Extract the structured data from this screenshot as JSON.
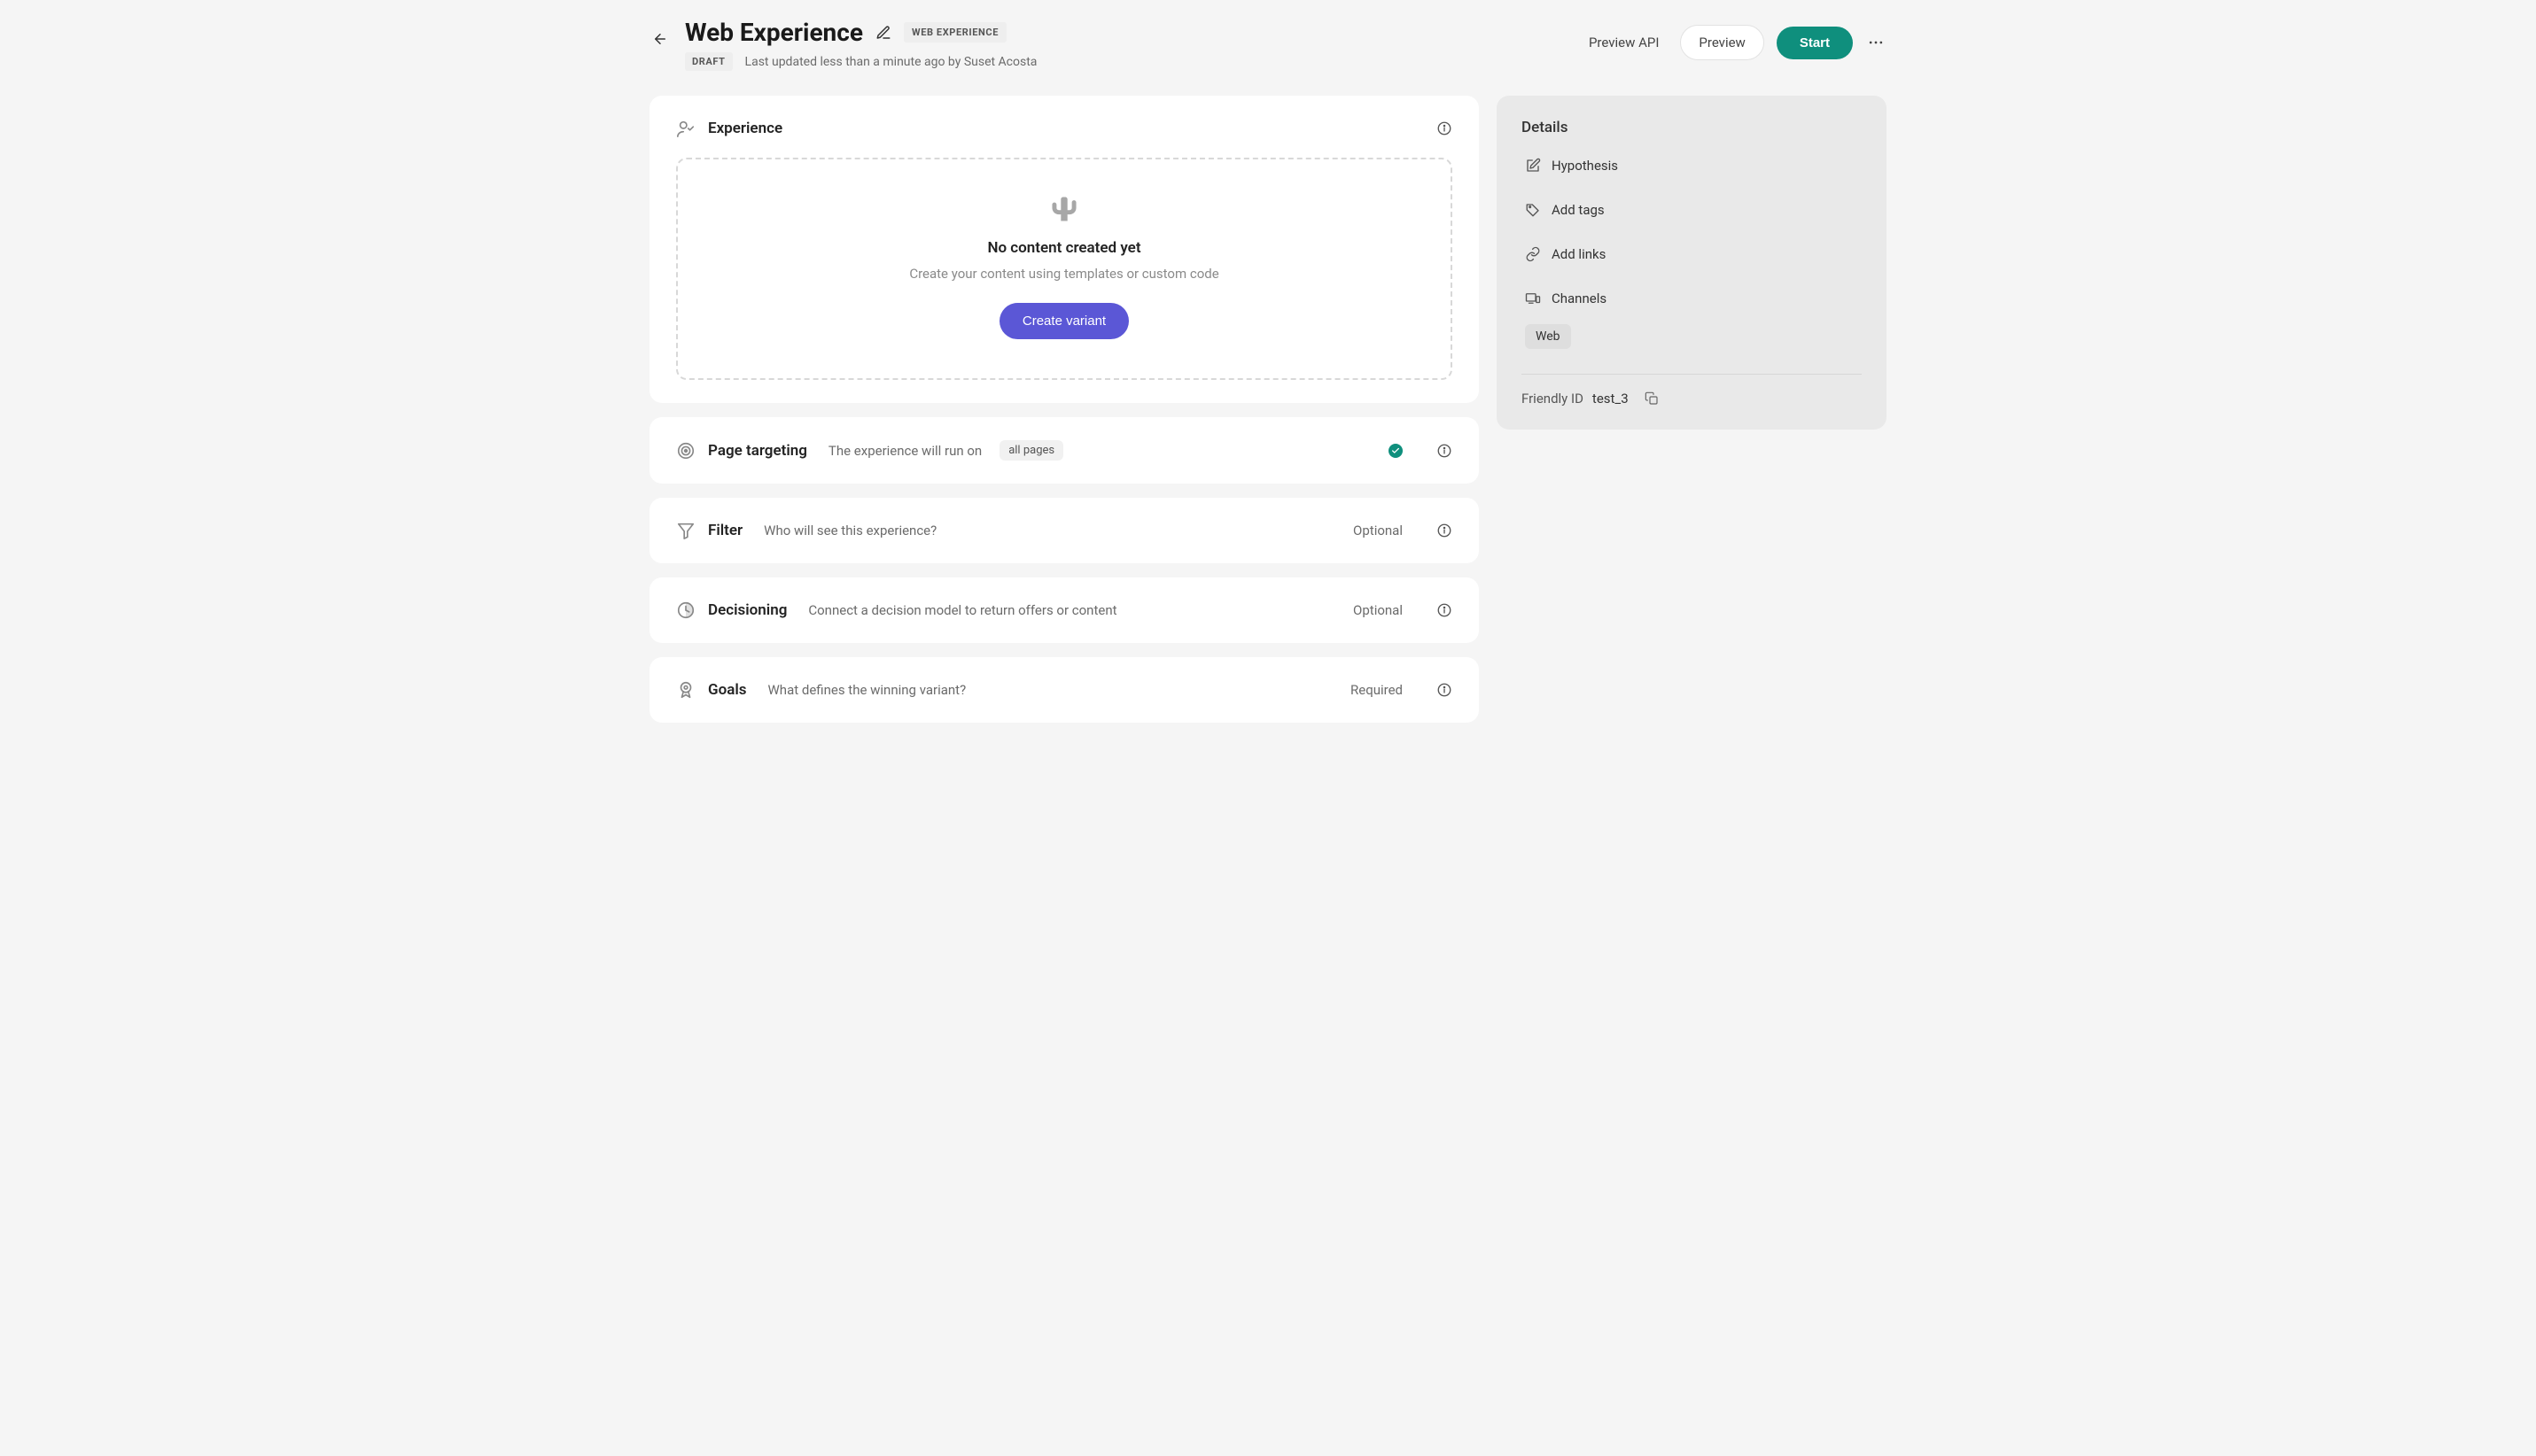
{
  "header": {
    "title": "Web Experience",
    "type_chip": "WEB EXPERIENCE",
    "status_chip": "DRAFT",
    "updated": "Last updated less than a minute ago by Suset Acosta",
    "preview_api": "Preview API",
    "preview": "Preview",
    "start": "Start"
  },
  "experience": {
    "title": "Experience",
    "empty_title": "No content created yet",
    "empty_sub": "Create your content using templates or custom code",
    "create_label": "Create variant"
  },
  "sections": {
    "page_targeting": {
      "title": "Page targeting",
      "desc": "The experience will run on",
      "scope": "all pages"
    },
    "filter": {
      "title": "Filter",
      "desc": "Who will see this experience?",
      "status": "Optional"
    },
    "decisioning": {
      "title": "Decisioning",
      "desc": "Connect a decision model to return offers or content",
      "status": "Optional"
    },
    "goals": {
      "title": "Goals",
      "desc": "What defines the winning variant?",
      "status": "Required"
    }
  },
  "details": {
    "title": "Details",
    "hypothesis": "Hypothesis",
    "add_tags": "Add tags",
    "add_links": "Add links",
    "channels_label": "Channels",
    "channels": [
      "Web"
    ],
    "friendly_id_label": "Friendly ID",
    "friendly_id": "test_3"
  }
}
